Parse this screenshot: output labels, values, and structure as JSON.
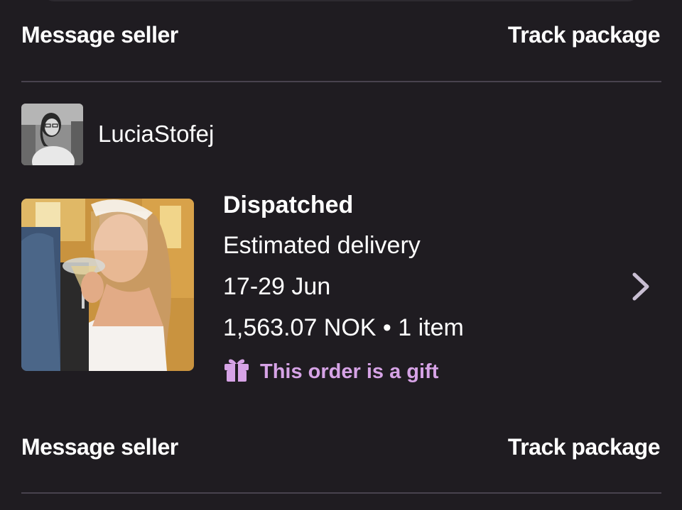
{
  "order_top": {
    "message_seller_label": "Message seller",
    "track_package_label": "Track package"
  },
  "seller": {
    "name": "LuciaStofej"
  },
  "order": {
    "status": "Dispatched",
    "delivery_label": "Estimated delivery",
    "delivery_dates": "17-29 Jun",
    "total_and_items": "1,563.07 NOK • 1 item",
    "gift_label": "This order is a gift"
  },
  "order_bottom": {
    "message_seller_label": "Message seller",
    "track_package_label": "Track package"
  },
  "icons": {
    "gift": "gift-icon",
    "chevron": "chevron-right-icon"
  },
  "colors": {
    "background": "#1f1c21",
    "divider": "#48434e",
    "gift_accent": "#d6a3e6",
    "chevron": "#c9bfd3"
  }
}
